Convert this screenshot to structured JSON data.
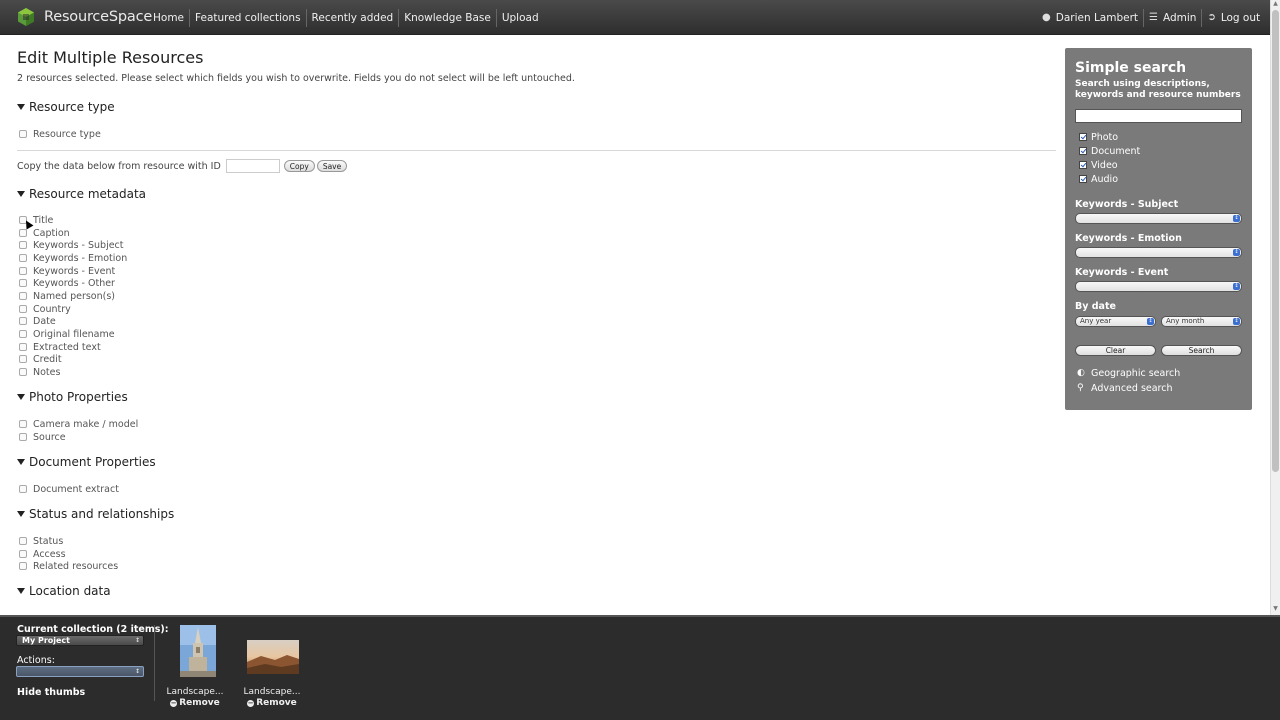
{
  "header": {
    "logo_text": "ResourceSpace",
    "nav_left": [
      "Home",
      "Featured collections",
      "Recently added",
      "Knowledge Base",
      "Upload"
    ],
    "user": "Darien Lambert",
    "admin": "Admin",
    "logout": "Log out"
  },
  "main": {
    "title": "Edit Multiple Resources",
    "description": "2 resources selected. Please select which fields you wish to overwrite. Fields you do not select will be left untouched.",
    "resource_type_section": "Resource type",
    "resource_type_field": "Resource type",
    "copy_label": "Copy the data below from resource with ID",
    "copy_input_value": "",
    "copy_button": "Copy",
    "save_button": "Save",
    "sections": [
      {
        "title": "Resource metadata",
        "fields": [
          "Title",
          "Caption",
          "Keywords - Subject",
          "Keywords - Emotion",
          "Keywords - Event",
          "Keywords - Other",
          "Named person(s)",
          "Country",
          "Date",
          "Original filename",
          "Extracted text",
          "Credit",
          "Notes"
        ]
      },
      {
        "title": "Photo Properties",
        "fields": [
          "Camera make / model",
          "Source"
        ]
      },
      {
        "title": "Document Properties",
        "fields": [
          "Document extract"
        ]
      },
      {
        "title": "Status and relationships",
        "fields": [
          "Status",
          "Access",
          "Related resources"
        ]
      },
      {
        "title": "Location data",
        "fields": []
      }
    ]
  },
  "search": {
    "title": "Simple search",
    "description": "Search using descriptions, keywords and resource numbers",
    "input_value": "",
    "types": [
      "Photo",
      "Document",
      "Video",
      "Audio"
    ],
    "keywords_subject_label": "Keywords - Subject",
    "keywords_emotion_label": "Keywords - Emotion",
    "keywords_event_label": "Keywords - Event",
    "by_date_label": "By date",
    "year_value": "Any year",
    "month_value": "Any month",
    "clear_button": "Clear",
    "search_button": "Search",
    "geo_link": "Geographic search",
    "advanced_link": "Advanced search"
  },
  "collection": {
    "label_prefix": "Current collection (",
    "count": "2",
    "label_suffix": " items):",
    "name": "My Project",
    "actions_label": "Actions:",
    "hide_thumbs": "Hide thumbs",
    "items": [
      {
        "name": "Landscape...",
        "remove": "Remove"
      },
      {
        "name": "Landscape...",
        "remove": "Remove"
      }
    ]
  }
}
